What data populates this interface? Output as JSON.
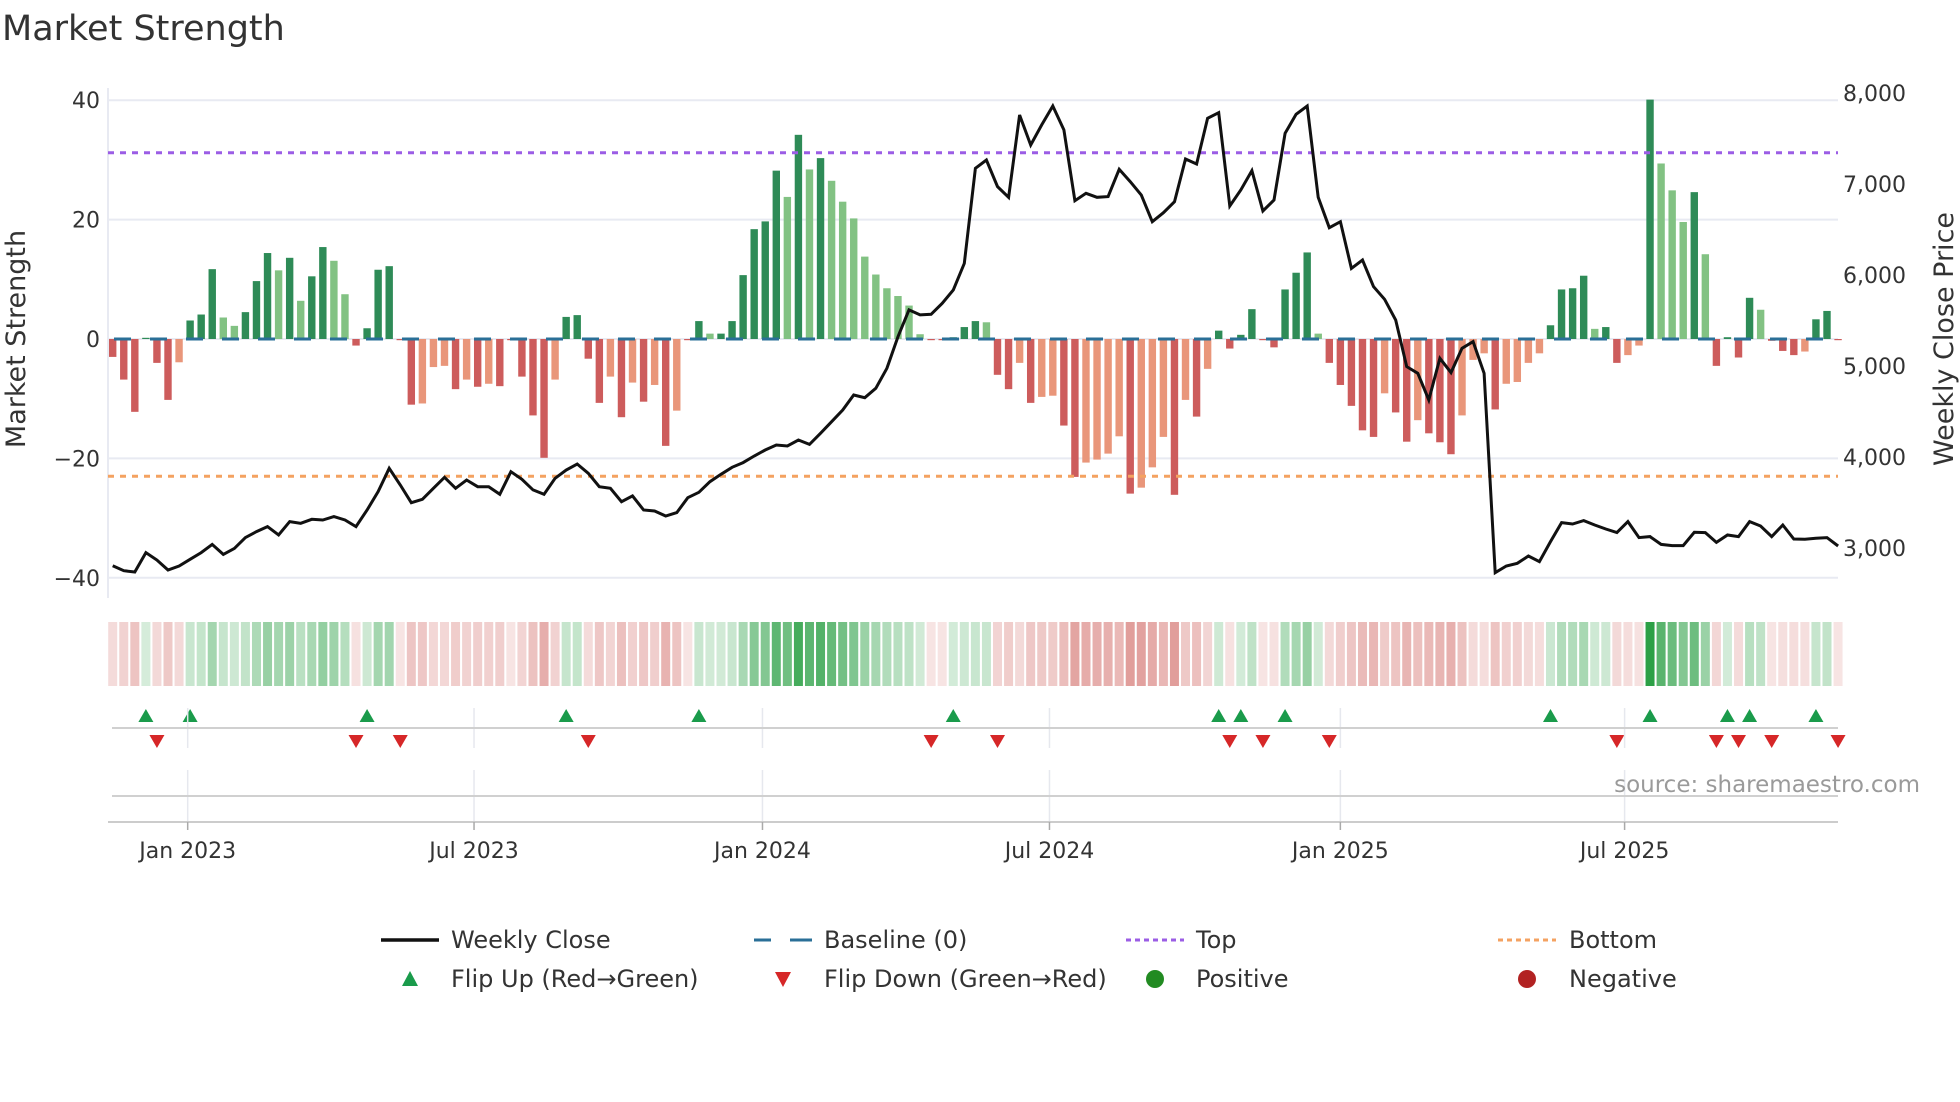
{
  "chart_data": {
    "type": "bar",
    "title": "Market Strength",
    "ylabel_left": "Market Strength",
    "ylabel_right": "Weekly Close Price",
    "ylim_left": [
      -42,
      42
    ],
    "ylim_right": [
      2640,
      8030
    ],
    "yticks_left": [
      {
        "v": 40,
        "label": "40"
      },
      {
        "v": 20,
        "label": "20"
      },
      {
        "v": 0,
        "label": "0"
      },
      {
        "v": -20,
        "label": "−20"
      },
      {
        "v": -40,
        "label": "−40"
      }
    ],
    "yticks_right": [
      {
        "v": 8000,
        "label": "8,000"
      },
      {
        "v": 7000,
        "label": "7,000"
      },
      {
        "v": 6000,
        "label": "6,000"
      },
      {
        "v": 5000,
        "label": "5,000"
      },
      {
        "v": 4000,
        "label": "4,000"
      },
      {
        "v": 3000,
        "label": "3,000"
      }
    ],
    "xticks": [
      {
        "week": 6.78,
        "label": "Jan 2023"
      },
      {
        "week": 32.67,
        "label": "Jul 2023"
      },
      {
        "week": 58.75,
        "label": "Jan 2024"
      },
      {
        "week": 84.7,
        "label": "Jul 2024"
      },
      {
        "week": 111.0,
        "label": "Jan 2025"
      },
      {
        "week": 136.7,
        "label": "Jul 2025"
      }
    ],
    "grid": true,
    "top_level": 31.2,
    "bottom_level": -23,
    "baseline": 0,
    "strength": [
      -3.0,
      -6.8,
      -12.2,
      0.2,
      -4.0,
      -10.2,
      -3.9,
      3.1,
      4.1,
      11.7,
      3.6,
      2.2,
      4.5,
      9.7,
      14.4,
      11.5,
      13.6,
      6.4,
      10.5,
      15.4,
      13.1,
      7.5,
      -1.1,
      1.8,
      11.6,
      12.2,
      -0.2,
      -11.0,
      -10.8,
      -4.7,
      -4.5,
      -8.4,
      -6.8,
      -8.0,
      -7.5,
      -7.9,
      -0.2,
      -6.3,
      -12.8,
      -19.9,
      -6.8,
      3.7,
      4.0,
      -3.3,
      -10.7,
      -6.3,
      -13.1,
      -7.3,
      -10.5,
      -7.7,
      -17.9,
      -12.0,
      -0.2,
      3.0,
      0.9,
      0.9,
      3.0,
      10.7,
      18.4,
      19.7,
      28.2,
      23.8,
      34.2,
      28.4,
      30.3,
      26.5,
      23.0,
      20.2,
      13.8,
      10.8,
      8.5,
      7.2,
      5.6,
      0.8,
      -0.2,
      -0.2,
      0.3,
      2.0,
      3.0,
      2.8,
      -6.0,
      -8.4,
      -4.0,
      -10.7,
      -9.7,
      -9.5,
      -14.5,
      -23.1,
      -20.7,
      -20.2,
      -19.2,
      -16.3,
      -25.9,
      -24.9,
      -21.5,
      -16.4,
      -26.1,
      -10.2,
      -13.0,
      -5.0,
      1.4,
      -1.6,
      0.7,
      5.0,
      -0.2,
      -1.4,
      8.3,
      11.1,
      14.5,
      0.9,
      -4.0,
      -7.7,
      -11.2,
      -15.3,
      -16.4,
      -9.1,
      -12.3,
      -17.2,
      -13.6,
      -15.8,
      -17.3,
      -19.3,
      -12.8,
      -3.5,
      -2.4,
      -11.8,
      -7.5,
      -7.2,
      -4.0,
      -2.4,
      2.3,
      8.3,
      8.5,
      10.6,
      1.7,
      2.0,
      -4.0,
      -2.7,
      -1.1,
      40.1,
      29.4,
      24.9,
      19.6,
      24.6,
      14.2,
      -4.5,
      0.3,
      -3.1,
      6.9,
      4.9,
      -0.3,
      -2.0,
      -2.7,
      -2.1,
      3.3,
      4.7,
      -0.2
    ],
    "shade": "DDDDDDLDDDLLDDDLDLDDLLDDDDDDLLLDLDLDDDDDLDDDDLDLDLDLDDLDDDDDDLDLDLLLLLLLLLDDDDDLDDLDLLDDLLLLDLLLDLDLDDDDDDDDDLDDDDDLDDLDDDLLLDLLLLDDDDLDDLLDLLLDLDDDDLDDDLDDD",
    "weekly_close": [
      2806,
      2751,
      2736,
      2949,
      2868,
      2758,
      2802,
      2876,
      2949,
      3040,
      2930,
      2996,
      3114,
      3180,
      3235,
      3143,
      3290,
      3271,
      3315,
      3308,
      3345,
      3308,
      3235,
      3418,
      3619,
      3876,
      3692,
      3498,
      3535,
      3656,
      3777,
      3656,
      3747,
      3674,
      3674,
      3590,
      3839,
      3755,
      3638,
      3590,
      3766,
      3857,
      3923,
      3821,
      3674,
      3656,
      3509,
      3572,
      3418,
      3407,
      3352,
      3389,
      3553,
      3612,
      3729,
      3810,
      3887,
      3938,
      4011,
      4077,
      4132,
      4121,
      4187,
      4139,
      4260,
      4388,
      4517,
      4681,
      4652,
      4755,
      4975,
      5323,
      5616,
      5561,
      5568,
      5689,
      5835,
      6128,
      7172,
      7264,
      6971,
      6854,
      7758,
      7429,
      7649,
      7857,
      7594,
      6817,
      6898,
      6854,
      6861,
      7161,
      7026,
      6879,
      6586,
      6685,
      6806,
      7275,
      7220,
      7722,
      7784,
      6758,
      6934,
      7147,
      6703,
      6824,
      7557,
      7766,
      7857,
      6854,
      6520,
      6586,
      6073,
      6165,
      5872,
      5733,
      5506,
      4993,
      4920,
      4627,
      5085,
      4927,
      5194,
      5268,
      4920,
      2729,
      2802,
      2832,
      2912,
      2850,
      3070,
      3279,
      3264,
      3301,
      3253,
      3209,
      3169,
      3290,
      3114,
      3125,
      3040,
      3026,
      3026,
      3172,
      3169,
      3062,
      3143,
      3125,
      3290,
      3242,
      3125,
      3253,
      3099,
      3096,
      3107,
      3114,
      3022
    ],
    "flip_up_weeks": [
      3,
      7,
      23,
      41,
      53,
      76,
      100,
      102,
      106,
      130,
      139,
      146,
      148,
      154
    ],
    "flip_down_weeks": [
      4,
      22,
      26,
      43,
      74,
      80,
      101,
      104,
      110,
      136,
      145,
      147,
      150,
      156
    ],
    "legend": {
      "placement": "bottom",
      "items": [
        {
          "key": "weekly_close",
          "label": "Weekly Close"
        },
        {
          "key": "baseline",
          "label": "Baseline (0)"
        },
        {
          "key": "top",
          "label": "Top"
        },
        {
          "key": "bottom",
          "label": "Bottom"
        },
        {
          "key": "flip_up",
          "label": "Flip Up (Red→Green)"
        },
        {
          "key": "flip_down",
          "label": "Flip Down (Green→Red)"
        },
        {
          "key": "positive",
          "label": "Positive"
        },
        {
          "key": "negative",
          "label": "Negative"
        }
      ]
    },
    "source": "source: sharemaestro.com",
    "colors": {
      "bar_pos_strong": "#2e8b57",
      "bar_pos_weak": "#82c283",
      "bar_neg_strong": "#cd5c5c",
      "bar_neg_weak": "#e9967a",
      "line": "#111111",
      "baseline": "#2a6f97",
      "top": "#9b5de5",
      "bottom": "#f4a261",
      "flip_up": "#1a9b4b",
      "flip_down": "#d62728",
      "positive": "#228b22",
      "negative": "#b22222",
      "grid": "#e8eaf2"
    }
  }
}
